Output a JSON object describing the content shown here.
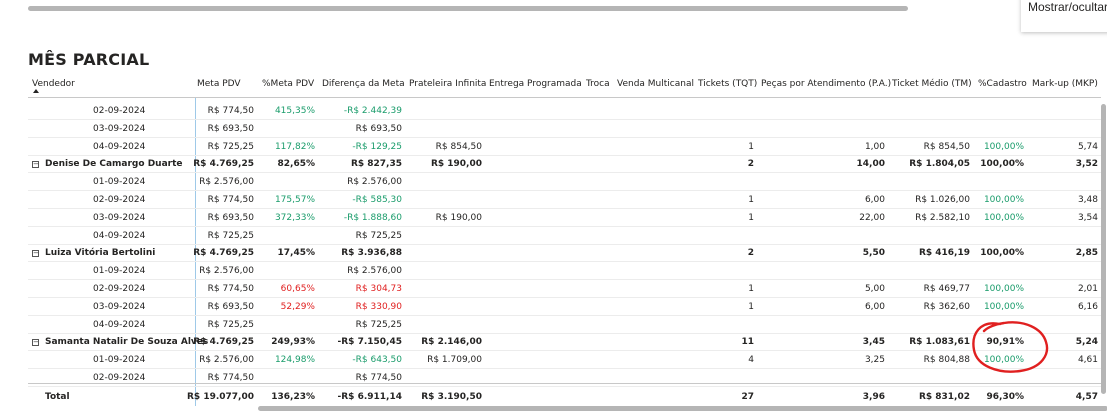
{
  "tooltip": "Mostrar/ocultar",
  "title": "MÊS PARCIAL",
  "headers": [
    "Vendedor",
    "Meta PDV",
    "%Meta PDV",
    "Diferença da Meta",
    "Prateleira Infinita",
    "Entrega Programada",
    "Troca",
    "Venda Multicanal",
    "Tickets (TQT)",
    "Peças por Atendimento (P.A.)",
    "Ticket Médio (TM)",
    "%Cadastro",
    "Mark-up (MKP)"
  ],
  "rows": [
    {
      "type": "date",
      "label": "02-09-2024",
      "meta": "R$ 774,50",
      "pct": "415,35%",
      "pct_color": "green",
      "dif": "-R$ 2.442,39",
      "dif_color": "green",
      "prat": "",
      "tickets": "",
      "pa": "",
      "tm": "",
      "cad": "",
      "cad_color": "",
      "mkp": ""
    },
    {
      "type": "date",
      "label": "03-09-2024",
      "meta": "R$ 693,50",
      "pct": "",
      "pct_color": "",
      "dif": "R$ 693,50",
      "dif_color": "",
      "prat": "",
      "tickets": "",
      "pa": "",
      "tm": "",
      "cad": "",
      "cad_color": "",
      "mkp": ""
    },
    {
      "type": "date",
      "label": "04-09-2024",
      "meta": "R$ 725,25",
      "pct": "117,82%",
      "pct_color": "green",
      "dif": "-R$ 129,25",
      "dif_color": "green",
      "prat": "R$ 854,50",
      "tickets": "1",
      "pa": "1,00",
      "tm": "R$ 854,50",
      "cad": "100,00%",
      "cad_color": "green",
      "mkp": "5,74"
    },
    {
      "type": "group",
      "label": "Denise De Camargo Duarte",
      "meta": "R$ 4.769,25",
      "pct": "82,65%",
      "pct_color": "",
      "dif": "R$ 827,35",
      "dif_color": "",
      "prat": "R$ 190,00",
      "tickets": "2",
      "pa": "14,00",
      "tm": "R$ 1.804,05",
      "cad": "100,00%",
      "cad_color": "",
      "mkp": "3,52"
    },
    {
      "type": "date",
      "label": "01-09-2024",
      "meta": "R$ 2.576,00",
      "pct": "",
      "pct_color": "",
      "dif": "R$ 2.576,00",
      "dif_color": "",
      "prat": "",
      "tickets": "",
      "pa": "",
      "tm": "",
      "cad": "",
      "cad_color": "",
      "mkp": ""
    },
    {
      "type": "date",
      "label": "02-09-2024",
      "meta": "R$ 774,50",
      "pct": "175,57%",
      "pct_color": "green",
      "dif": "-R$ 585,30",
      "dif_color": "green",
      "prat": "",
      "tickets": "1",
      "pa": "6,00",
      "tm": "R$ 1.026,00",
      "cad": "100,00%",
      "cad_color": "green",
      "mkp": "3,48"
    },
    {
      "type": "date",
      "label": "03-09-2024",
      "meta": "R$ 693,50",
      "pct": "372,33%",
      "pct_color": "green",
      "dif": "-R$ 1.888,60",
      "dif_color": "green",
      "prat": "R$ 190,00",
      "tickets": "1",
      "pa": "22,00",
      "tm": "R$ 2.582,10",
      "cad": "100,00%",
      "cad_color": "green",
      "mkp": "3,54"
    },
    {
      "type": "date",
      "label": "04-09-2024",
      "meta": "R$ 725,25",
      "pct": "",
      "pct_color": "",
      "dif": "R$ 725,25",
      "dif_color": "",
      "prat": "",
      "tickets": "",
      "pa": "",
      "tm": "",
      "cad": "",
      "cad_color": "",
      "mkp": ""
    },
    {
      "type": "group",
      "label": "Luiza Vitória Bertolini",
      "meta": "R$ 4.769,25",
      "pct": "17,45%",
      "pct_color": "",
      "dif": "R$ 3.936,88",
      "dif_color": "",
      "prat": "",
      "tickets": "2",
      "pa": "5,50",
      "tm": "R$ 416,19",
      "cad": "100,00%",
      "cad_color": "",
      "mkp": "2,85"
    },
    {
      "type": "date",
      "label": "01-09-2024",
      "meta": "R$ 2.576,00",
      "pct": "",
      "pct_color": "",
      "dif": "R$ 2.576,00",
      "dif_color": "",
      "prat": "",
      "tickets": "",
      "pa": "",
      "tm": "",
      "cad": "",
      "cad_color": "",
      "mkp": ""
    },
    {
      "type": "date",
      "label": "02-09-2024",
      "meta": "R$ 774,50",
      "pct": "60,65%",
      "pct_color": "red",
      "dif": "R$ 304,73",
      "dif_color": "red",
      "prat": "",
      "tickets": "1",
      "pa": "5,00",
      "tm": "R$ 469,77",
      "cad": "100,00%",
      "cad_color": "green",
      "mkp": "2,01"
    },
    {
      "type": "date",
      "label": "03-09-2024",
      "meta": "R$ 693,50",
      "pct": "52,29%",
      "pct_color": "red",
      "dif": "R$ 330,90",
      "dif_color": "red",
      "prat": "",
      "tickets": "1",
      "pa": "6,00",
      "tm": "R$ 362,60",
      "cad": "100,00%",
      "cad_color": "green",
      "mkp": "6,16"
    },
    {
      "type": "date",
      "label": "04-09-2024",
      "meta": "R$ 725,25",
      "pct": "",
      "pct_color": "",
      "dif": "R$ 725,25",
      "dif_color": "",
      "prat": "",
      "tickets": "",
      "pa": "",
      "tm": "",
      "cad": "",
      "cad_color": "",
      "mkp": ""
    },
    {
      "type": "group",
      "label": "Samanta Natalir De Souza Alves",
      "meta": "R$ 4.769,25",
      "pct": "249,93%",
      "pct_color": "",
      "dif": "-R$ 7.150,45",
      "dif_color": "",
      "prat": "R$ 2.146,00",
      "tickets": "11",
      "pa": "3,45",
      "tm": "R$ 1.083,61",
      "cad": "90,91%",
      "cad_color": "",
      "mkp": "5,24"
    },
    {
      "type": "date",
      "label": "01-09-2024",
      "meta": "R$ 2.576,00",
      "pct": "124,98%",
      "pct_color": "green",
      "dif": "-R$ 643,50",
      "dif_color": "green",
      "prat": "R$ 1.709,00",
      "tickets": "4",
      "pa": "3,25",
      "tm": "R$ 804,88",
      "cad": "100,00%",
      "cad_color": "green",
      "mkp": "4,61"
    },
    {
      "type": "date",
      "label": "02-09-2024",
      "meta": "R$ 774,50",
      "pct": "",
      "pct_color": "",
      "dif": "R$ 774,50",
      "dif_color": "",
      "prat": "",
      "tickets": "",
      "pa": "",
      "tm": "",
      "cad": "",
      "cad_color": "",
      "mkp": ""
    }
  ],
  "total": {
    "label": "Total",
    "meta": "R$ 19.077,00",
    "pct": "136,23%",
    "dif": "-R$ 6.911,14",
    "prat": "R$ 3.190,50",
    "tickets": "27",
    "pa": "3,96",
    "tm": "R$ 831,02",
    "cad": "96,30%",
    "mkp": "4,57"
  },
  "colors": {
    "green": "#1a9c6b",
    "red": "#e02020",
    "annotation": "#e02020",
    "grid_line": "#9ec9e8"
  }
}
